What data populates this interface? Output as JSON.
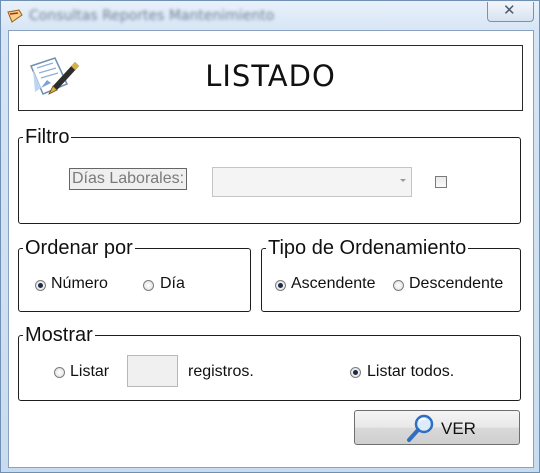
{
  "window": {
    "title": "Consultas Reportes Mantenimiento",
    "close_glyph": "✕"
  },
  "header": {
    "title": "LISTADO",
    "icon": "document-pen-icon"
  },
  "filtro": {
    "legend": "Filtro",
    "dias_label": "Días Laborales:",
    "dias_value": "",
    "checkbox_checked": false
  },
  "ordenar": {
    "legend": "Ordenar por",
    "options": [
      "Número",
      "Día"
    ],
    "selected": "Número"
  },
  "tipo": {
    "legend": "Tipo de Ordenamiento",
    "options": [
      "Ascendente",
      "Descendente"
    ],
    "selected": "Ascendente"
  },
  "mostrar": {
    "legend": "Mostrar",
    "listar_label": "Listar",
    "registros_value": "",
    "registros_label": "registros.",
    "listar_todos_label": "Listar todos.",
    "selected": "Listar todos."
  },
  "actions": {
    "ver_label": "VER",
    "ver_icon": "magnifier-icon"
  }
}
